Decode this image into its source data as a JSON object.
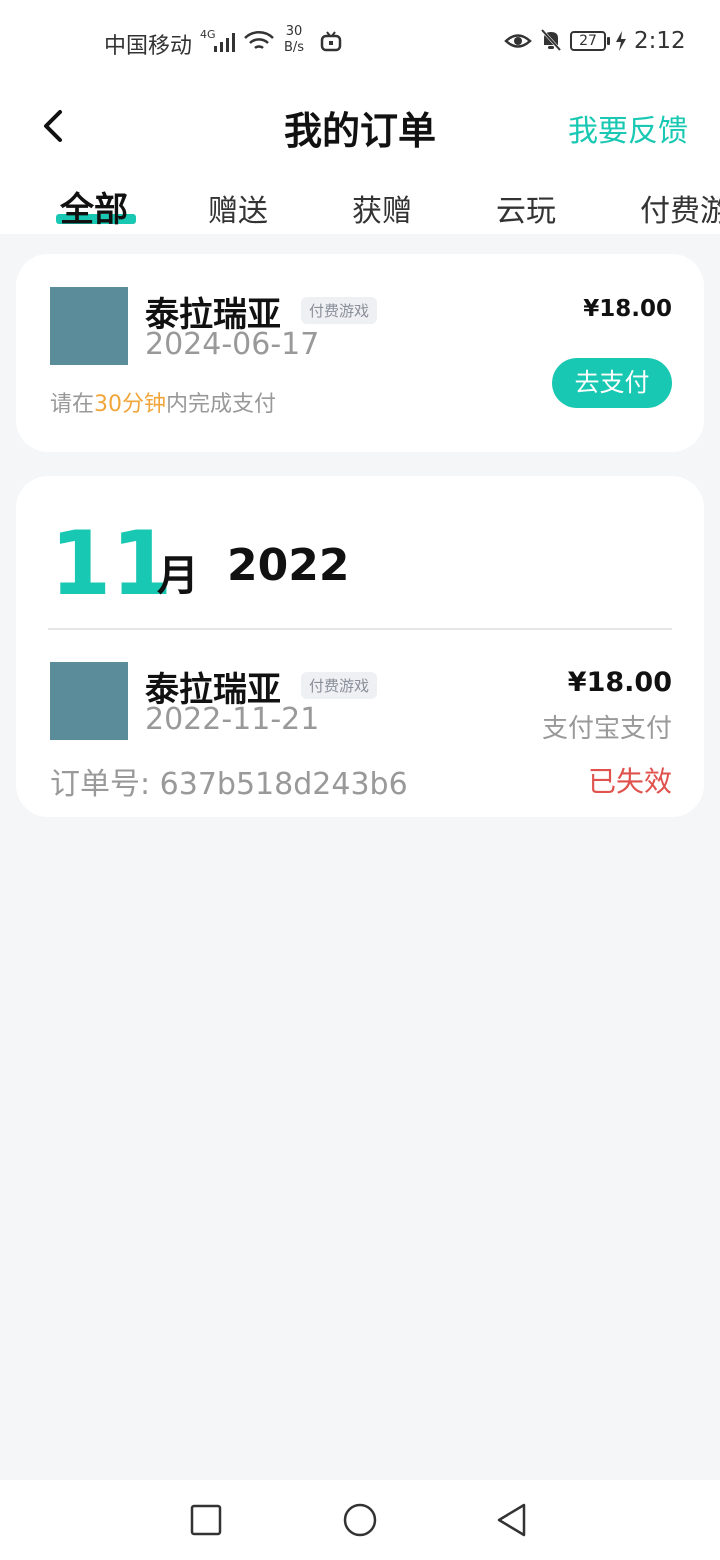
{
  "status_bar": {
    "carrier": "中国移动",
    "network": "4G",
    "speed_value": "30",
    "speed_unit": "B/s",
    "battery": "27",
    "time": "2:12"
  },
  "header": {
    "title": "我的订单",
    "feedback_label": "我要反馈"
  },
  "tabs": [
    {
      "label": "全部",
      "active": true
    },
    {
      "label": "赠送",
      "active": false
    },
    {
      "label": "获赠",
      "active": false
    },
    {
      "label": "云玩",
      "active": false
    },
    {
      "label": "付费游",
      "active": false
    }
  ],
  "pending_order": {
    "game_name": "泰拉瑞亚",
    "tag": "付费游戏",
    "date": "2024-06-17",
    "price": "¥18.00",
    "pay_button": "去支付",
    "hint_prefix": "请在",
    "hint_highlight": "30分钟",
    "hint_suffix": "内完成支付"
  },
  "history": {
    "month_num": "11",
    "month_unit": "月",
    "year": "2022",
    "orders": [
      {
        "game_name": "泰拉瑞亚",
        "tag": "付费游戏",
        "date": "2022-11-21",
        "price": "¥18.00",
        "pay_method": "支付宝支付",
        "order_label": "订单号:",
        "order_id": "637b518d243b6",
        "status": "已失效"
      }
    ]
  },
  "colors": {
    "accent": "#19c8b2",
    "highlight": "#f0a63a",
    "expired": "#e0524d",
    "thumbnail": "#5a8c99",
    "background": "#f5f6f8"
  }
}
